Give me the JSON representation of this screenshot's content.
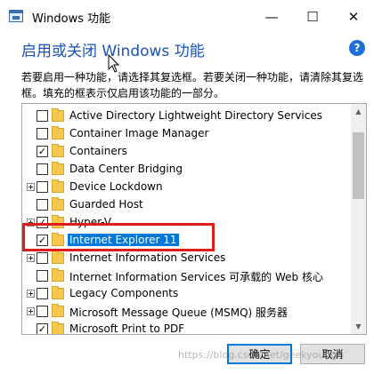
{
  "window": {
    "title": "Windows 功能",
    "minimize_glyph": "—",
    "maximize_glyph": "☐",
    "close_glyph": "✕"
  },
  "header": {
    "title": "启用或关闭 Windows 功能",
    "help_glyph": "?"
  },
  "description": {
    "line1": "若要启用一种功能，请选择其复选框。若要关闭一种功能，请清除其复选框。填充的框表示仅启用该功能的一部分。"
  },
  "features": [
    {
      "label": "Active Directory Lightweight Directory Services",
      "has_expander": false,
      "state": "unchecked",
      "selected": false
    },
    {
      "label": "Container Image Manager",
      "has_expander": false,
      "state": "unchecked",
      "selected": false
    },
    {
      "label": "Containers",
      "has_expander": false,
      "state": "checked",
      "selected": false
    },
    {
      "label": "Data Center Bridging",
      "has_expander": false,
      "state": "unchecked",
      "selected": false
    },
    {
      "label": "Device Lockdown",
      "has_expander": true,
      "state": "unchecked",
      "selected": false
    },
    {
      "label": "Guarded Host",
      "has_expander": false,
      "state": "unchecked",
      "selected": false
    },
    {
      "label": "Hyper-V",
      "has_expander": true,
      "state": "checked",
      "selected": false
    },
    {
      "label": "Internet Explorer 11",
      "has_expander": false,
      "state": "checked",
      "selected": true
    },
    {
      "label": "Internet Information Services",
      "has_expander": true,
      "state": "unchecked",
      "selected": false
    },
    {
      "label": "Internet Information Services 可承载的 Web 核心",
      "has_expander": false,
      "state": "unchecked",
      "selected": false
    },
    {
      "label": "Legacy Components",
      "has_expander": true,
      "state": "unchecked",
      "selected": false
    },
    {
      "label": "Microsoft Message Queue (MSMQ) 服务器",
      "has_expander": true,
      "state": "unchecked",
      "selected": false
    },
    {
      "label": "Microsoft Print to PDF",
      "has_expander": false,
      "state": "checked",
      "selected": false
    }
  ],
  "buttons": {
    "ok": "确定",
    "cancel": "取消"
  },
  "watermark": "https://blog.csdn.net/geekyoung",
  "colors": {
    "header_blue": "#1a53b8",
    "selection_blue": "#0078d7",
    "annotation_red": "#e01b1b"
  }
}
